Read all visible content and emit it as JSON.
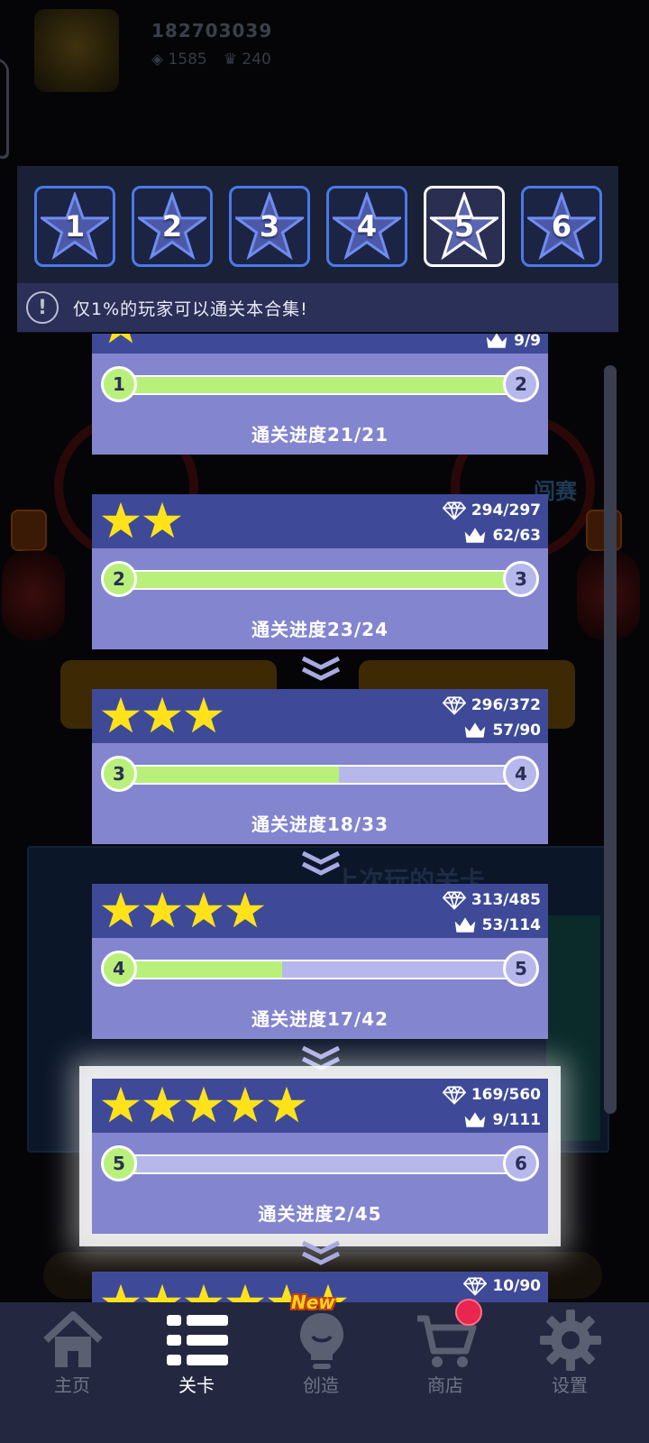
{
  "player": {
    "id": "182703039",
    "gems": "1585",
    "crowns": "240"
  },
  "background": {
    "event_label": "闯赛",
    "panel_title": "上次玩的关卡"
  },
  "tabs": [
    {
      "label": "1",
      "active": false
    },
    {
      "label": "2",
      "active": false
    },
    {
      "label": "3",
      "active": false
    },
    {
      "label": "4",
      "active": false
    },
    {
      "label": "5",
      "active": true
    },
    {
      "label": "6",
      "active": false
    }
  ],
  "notice": {
    "icon": "info-icon",
    "symbol": "!",
    "text": "仅1%的玩家可以通关本合集!"
  },
  "cards": [
    {
      "stars": 1,
      "crowns": "9/9",
      "from": "1",
      "to": "2",
      "progress_text": "通关进度21/21",
      "progress": 1.0
    },
    {
      "stars": 2,
      "gems": "294/297",
      "crowns": "62/63",
      "from": "2",
      "to": "3",
      "progress_text": "通关进度23/24",
      "progress": 0.958
    },
    {
      "stars": 3,
      "gems": "296/372",
      "crowns": "57/90",
      "from": "3",
      "to": "4",
      "progress_text": "通关进度18/33",
      "progress": 0.545
    },
    {
      "stars": 4,
      "gems": "313/485",
      "crowns": "53/114",
      "from": "4",
      "to": "5",
      "progress_text": "通关进度17/42",
      "progress": 0.405
    },
    {
      "stars": 5,
      "gems": "169/560",
      "crowns": "9/111",
      "from": "5",
      "to": "6",
      "progress_text": "通关进度2/45",
      "progress": 0.044,
      "highlighted": true
    },
    {
      "stars": 6,
      "gems": "10/90"
    }
  ],
  "nav": [
    {
      "label": "主页",
      "icon": "home-icon",
      "active": false
    },
    {
      "label": "关卡",
      "icon": "list-icon",
      "active": true
    },
    {
      "label": "创造",
      "icon": "lightbulb-icon",
      "active": false,
      "badge": "New"
    },
    {
      "label": "商店",
      "icon": "cart-icon",
      "active": false,
      "notification_dot": true
    },
    {
      "label": "设置",
      "icon": "gear-icon",
      "active": false
    }
  ],
  "colors": {
    "accent_border": "#4a7ae8",
    "progress_fill": "#b9f07a",
    "card_header": "#3e4a98",
    "card_body": "#8385cf",
    "star": "#ffe21a",
    "notification": "#e8264e"
  }
}
